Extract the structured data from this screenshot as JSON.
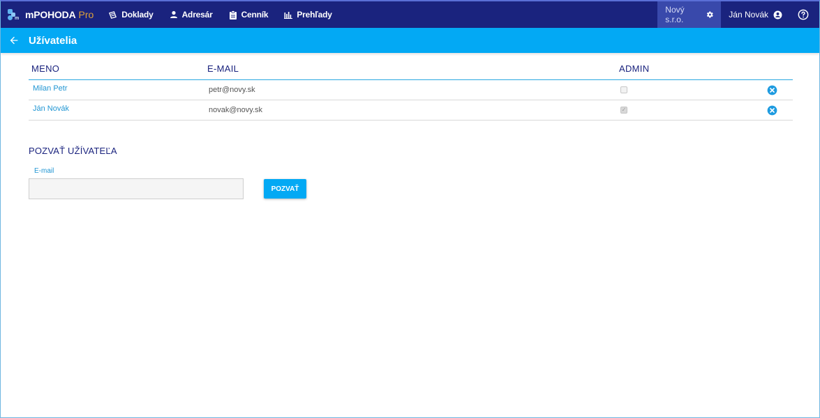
{
  "app": {
    "brand": "mPOHODA",
    "brand_suffix": "Pro"
  },
  "nav": {
    "items": [
      {
        "label": "Doklady",
        "icon": "documents-icon"
      },
      {
        "label": "Adresár",
        "icon": "person-icon"
      },
      {
        "label": "Cenník",
        "icon": "clipboard-icon"
      },
      {
        "label": "Prehľady",
        "icon": "bar-chart-icon"
      }
    ],
    "company": "Nový s.r.o.",
    "user": "Ján Novák"
  },
  "subheader": {
    "title": "Užívatelia"
  },
  "table": {
    "headers": {
      "name": "MENO",
      "email": "E-MAIL",
      "admin": "ADMIN"
    },
    "rows": [
      {
        "name": "Milan Petr",
        "email": "petr@novy.sk",
        "admin": false
      },
      {
        "name": "Ján Novák",
        "email": "novak@novy.sk",
        "admin": true
      }
    ]
  },
  "invite": {
    "title": "POZVAŤ UŽÍVATEĽA",
    "email_label": "E-mail",
    "email_value": "",
    "button_label": "POZVAŤ"
  },
  "colors": {
    "topbar": "#1a237e",
    "subbar": "#03a9f4",
    "company_bg": "#3949ab",
    "accent": "#2196d3",
    "brand_pro": "#e0a33a"
  }
}
